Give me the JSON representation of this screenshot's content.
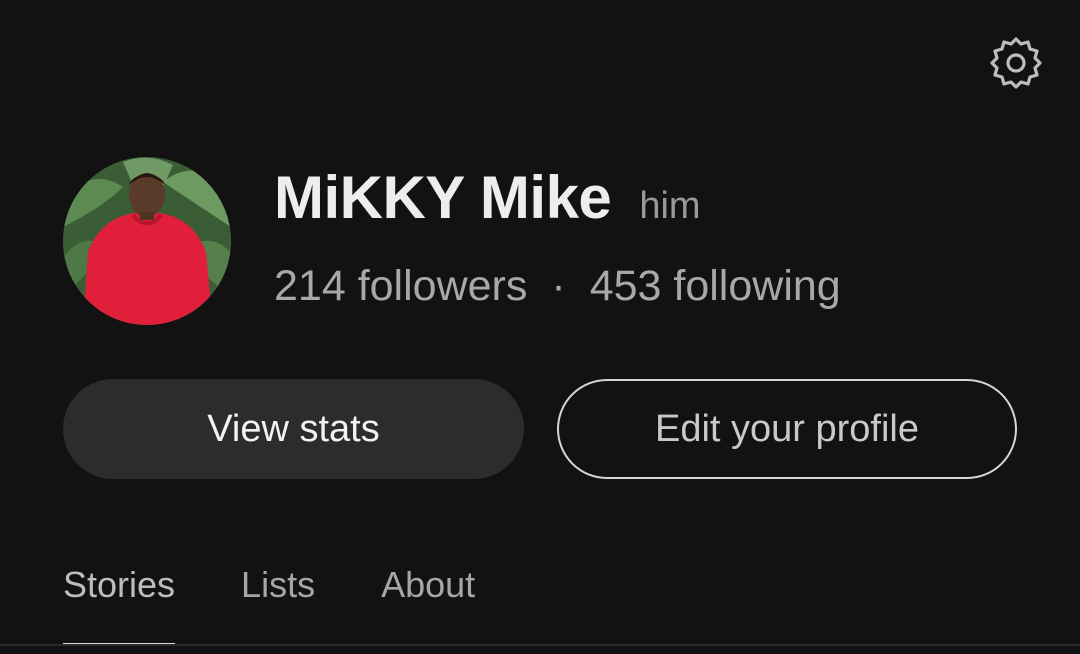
{
  "profile": {
    "name": "MiKKY Mike",
    "pronoun": "him",
    "followers": "214 followers",
    "separator": "·",
    "following": "453 following"
  },
  "actions": {
    "view_stats": "View stats",
    "edit_profile": "Edit your profile"
  },
  "tabs": [
    {
      "label": "Stories",
      "active": true
    },
    {
      "label": "Lists",
      "active": false
    },
    {
      "label": "About",
      "active": false
    }
  ],
  "icons": {
    "settings": "gear-icon",
    "avatar": "avatar-photo"
  },
  "colors": {
    "background": "#121212",
    "primary_button": "#2c2c2c",
    "outline": "#d6d6d6",
    "avatar_shirt": "#e0203a",
    "avatar_foliage": "#3f6a3a"
  }
}
